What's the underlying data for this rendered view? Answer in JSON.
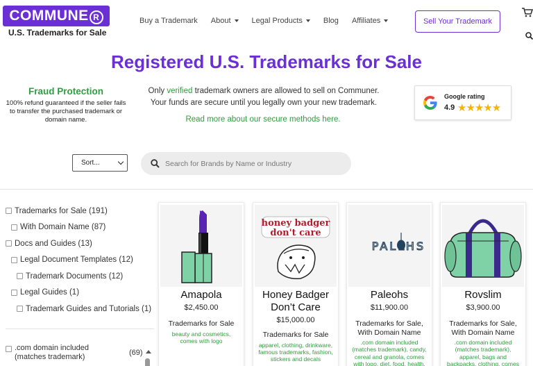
{
  "brand": {
    "name": "COMMUNER",
    "subtitle": "U.S. Trademarks for Sale",
    "color": "#6b2fd6"
  },
  "nav": {
    "items": [
      {
        "label": "Buy a Trademark",
        "dropdown": false
      },
      {
        "label": "About",
        "dropdown": true
      },
      {
        "label": "Legal Products",
        "dropdown": true
      },
      {
        "label": "Blog",
        "dropdown": false
      },
      {
        "label": "Affiliates",
        "dropdown": true
      }
    ],
    "cta": "Sell Your Trademark"
  },
  "title": "Registered U.S. Trademarks for Sale",
  "fraud": {
    "title": "Fraud Protection",
    "text": "100% refund guaranteed if the seller fails to transfer the purchased trademark or domain name."
  },
  "verify": {
    "before": "Only ",
    "highlight": "verified",
    "after": " trademark owners are allowed to sell on Communer.",
    "line2": "Your funds are secure until you legally own your new trademark.",
    "read_more": "Read more about our secure methods here."
  },
  "rating": {
    "label": "Google rating",
    "value": "4.9",
    "stars": "★★★★★"
  },
  "sort": {
    "label": "Sort..."
  },
  "search": {
    "placeholder": "Search for Brands by Name or Industry"
  },
  "filters": [
    {
      "label": "Trademarks for Sale (191)",
      "level": 0
    },
    {
      "label": "With Domain Name (87)",
      "level": 1
    },
    {
      "label": "Docs and Guides (13)",
      "level": 0
    },
    {
      "label": "Legal Document Templates (12)",
      "level": 1
    },
    {
      "label": "Trademark Documents (12)",
      "level": 2
    },
    {
      "label": "Legal Guides (1)",
      "level": 1
    },
    {
      "label": "Trademark Guides and Tutorials (1)",
      "level": 2
    }
  ],
  "domain_filter": {
    "label": ".com domain included (matches trademark)",
    "count": "(69)"
  },
  "products": [
    {
      "name": "Amapola",
      "price": "$2,450.00",
      "category": "Trademarks for Sale",
      "tags": "beauty and cosmetics, comes with logo"
    },
    {
      "name": "Honey Badger Don’t Care",
      "price": "$15,000.00",
      "category": "Trademarks for Sale",
      "tags": "apparel, clothing, drinkware, famous trademarks, fashion, stickers and decals",
      "logo_text": "honey badger don't care"
    },
    {
      "name": "Paleohs",
      "price": "$11,900.00",
      "category": "Trademarks for Sale, With Domain Name",
      "tags": ".com domain included (matches trademark), candy, cereal and granola, comes with logo, diet, food, health, health foods",
      "logo_text": "PALEOHS"
    },
    {
      "name": "Rovslim",
      "price": "$3,900.00",
      "category": "Trademarks for Sale, With Domain Name",
      "tags": ".com domain included (matches trademark), apparel, bags and backpacks, clothing, comes with logo"
    }
  ]
}
